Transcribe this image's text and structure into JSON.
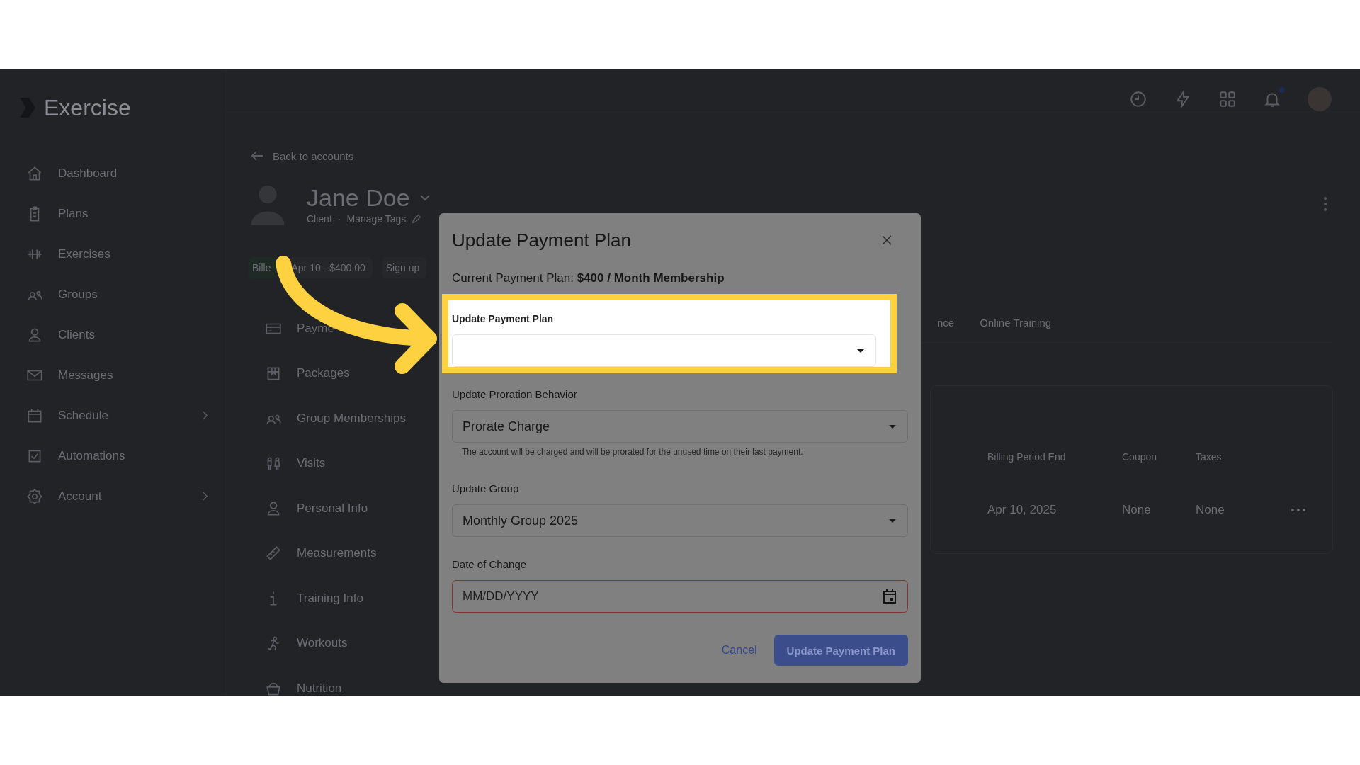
{
  "app": {
    "logo": "Exercise"
  },
  "sidebar": {
    "items": [
      {
        "label": "Dashboard",
        "expandable": false
      },
      {
        "label": "Plans",
        "expandable": false
      },
      {
        "label": "Exercises",
        "expandable": false
      },
      {
        "label": "Groups",
        "expandable": false
      },
      {
        "label": "Clients",
        "expandable": false
      },
      {
        "label": "Messages",
        "expandable": false
      },
      {
        "label": "Schedule",
        "expandable": true
      },
      {
        "label": "Automations",
        "expandable": false
      },
      {
        "label": "Account",
        "expandable": true
      }
    ]
  },
  "topbar": {
    "notifications_unread": true
  },
  "profile": {
    "back_link": "Back to accounts",
    "name": "Jane Doe",
    "role": "Client",
    "separator": "·",
    "tags_link": "Manage Tags",
    "chips": [
      "Bille",
      "Apr 10 - $400.00",
      "Sign up"
    ]
  },
  "client_menu": {
    "items": [
      "Payme",
      "Packages",
      "Group Memberships",
      "Visits",
      "Personal Info",
      "Measurements",
      "Training Info",
      "Workouts",
      "Nutrition"
    ]
  },
  "tabs": [
    {
      "label": "nce",
      "selected": false
    },
    {
      "label": "Online Training",
      "selected": false
    }
  ],
  "billing_table": {
    "columns": [
      "Billing Period End",
      "Coupon",
      "Taxes"
    ],
    "rows": [
      [
        "Apr 10, 2025",
        "None",
        "None"
      ]
    ]
  },
  "dialog": {
    "title": "Update Payment Plan",
    "current_plan": "Current Payment Plan: **$400 / Month Membership**",
    "fields": [
      {
        "kind": "select",
        "label": "Update Payment Plan",
        "highlighted": true,
        "error": false
      },
      {
        "kind": "select",
        "label": "Update Proration Behavior",
        "value": "Prorate Charge",
        "helper": "The account will be charged and will be prorated for the unused time on their last payment.",
        "highlighted": false,
        "error": false
      },
      {
        "kind": "select",
        "label": "Update Group",
        "value": "Monthly Group 2025",
        "highlighted": false,
        "error": false
      },
      {
        "kind": "date",
        "label": "Date of Change",
        "placeholder": "MM/DD/YYYY",
        "highlighted": false,
        "error": true
      }
    ],
    "cancel": "Cancel",
    "submit": "Update Payment Plan"
  }
}
